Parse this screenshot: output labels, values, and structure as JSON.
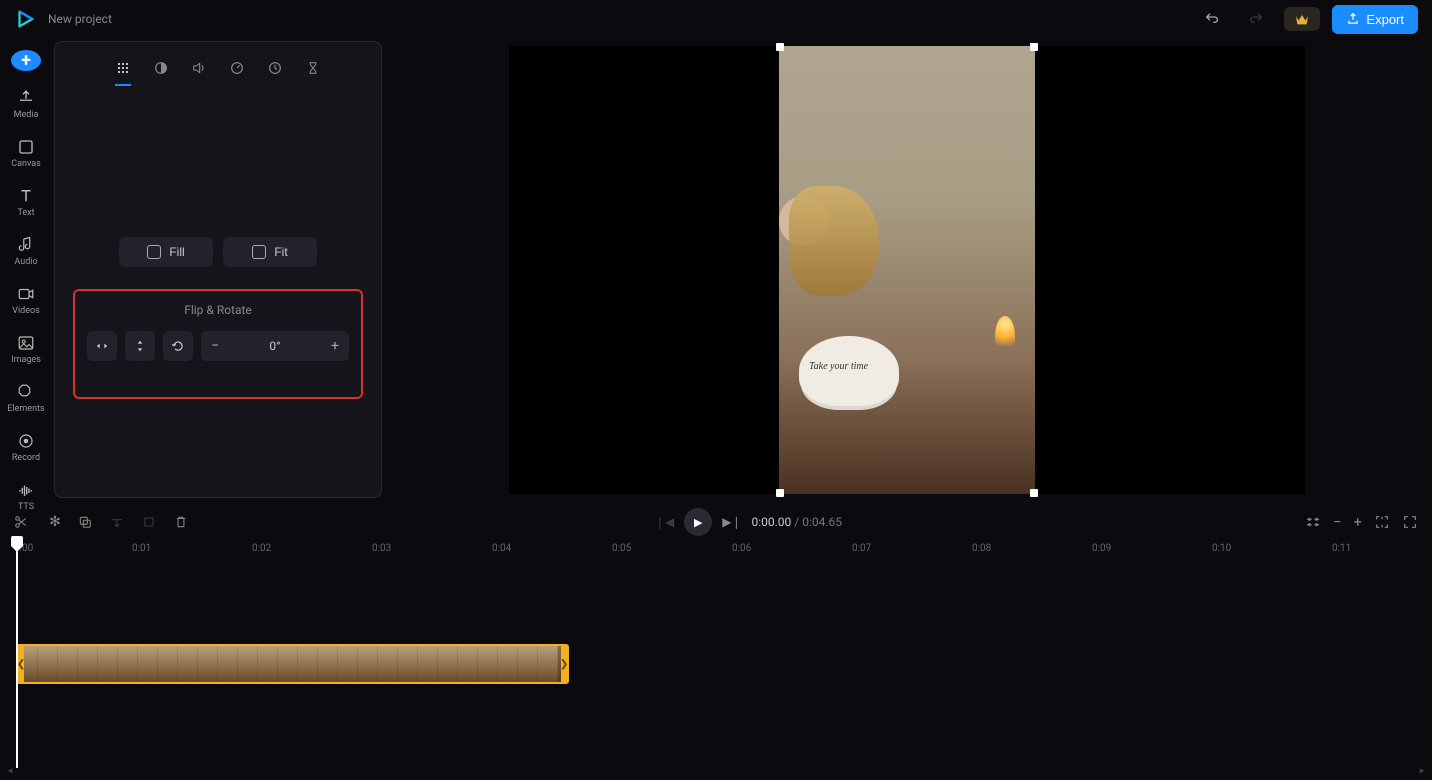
{
  "header": {
    "title": "New project",
    "export_label": "Export"
  },
  "sidebar": {
    "items": [
      {
        "label": "Media"
      },
      {
        "label": "Canvas"
      },
      {
        "label": "Text"
      },
      {
        "label": "Audio"
      },
      {
        "label": "Videos"
      },
      {
        "label": "Images"
      },
      {
        "label": "Elements"
      },
      {
        "label": "Record"
      },
      {
        "label": "TTS"
      }
    ]
  },
  "props": {
    "fill_label": "Fill",
    "fit_label": "Fit",
    "flip_rotate": {
      "title": "Flip & Rotate",
      "value": "0°"
    }
  },
  "preview": {
    "cup_text": "Take your time"
  },
  "transport": {
    "current_time": "0:00.00",
    "total_time": "0:04.65"
  },
  "timeline": {
    "marks": [
      "0:00",
      "0:01",
      "0:02",
      "0:03",
      "0:04",
      "0:05",
      "0:06",
      "0:07",
      "0:08",
      "0:09",
      "0:10",
      "0:11"
    ]
  }
}
